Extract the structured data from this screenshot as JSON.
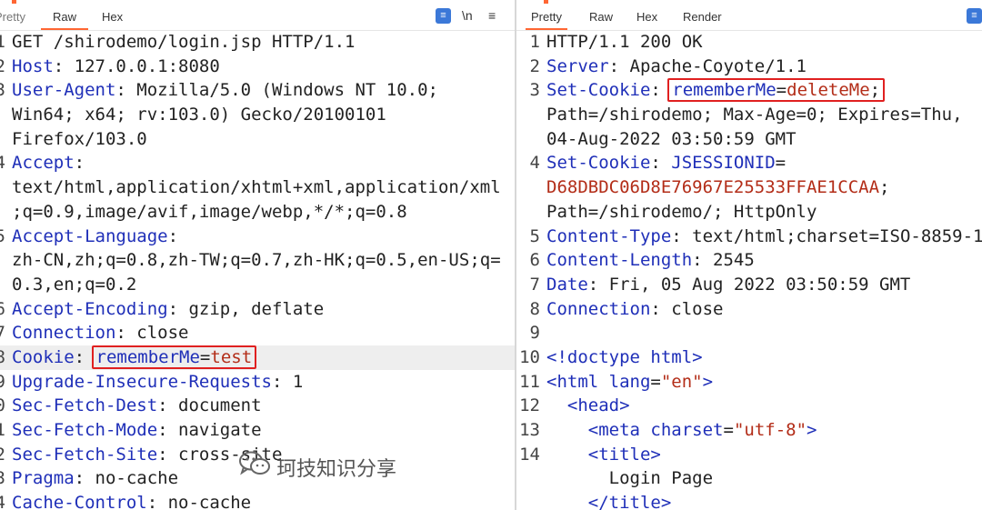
{
  "left": {
    "tabs": [
      "Pretty",
      "Raw",
      "Hex"
    ],
    "tools": {
      "pretty_icon": "text-format-icon",
      "newline": "\\n",
      "menu": "≡"
    },
    "lines": [
      {
        "n": "1",
        "parts": [
          [
            "v",
            "GET /shirodemo/login.jsp HTTP/1.1"
          ]
        ]
      },
      {
        "n": "2",
        "parts": [
          [
            "k",
            "Host"
          ],
          [
            "v",
            ": 127.0.0.1:8080"
          ]
        ]
      },
      {
        "n": "3",
        "parts": [
          [
            "k",
            "User-Agent"
          ],
          [
            "v",
            ": Mozilla/5.0 (Windows NT 10.0;"
          ]
        ]
      },
      {
        "n": "",
        "parts": [
          [
            "v",
            "Win64; x64; rv:103.0) Gecko/20100101"
          ]
        ]
      },
      {
        "n": "",
        "parts": [
          [
            "v",
            "Firefox/103.0"
          ]
        ]
      },
      {
        "n": "4",
        "parts": [
          [
            "k",
            "Accept"
          ],
          [
            "v",
            ":"
          ]
        ]
      },
      {
        "n": "",
        "parts": [
          [
            "v",
            "text/html,application/xhtml+xml,application/xml"
          ]
        ]
      },
      {
        "n": "",
        "parts": [
          [
            "v",
            ";q=0.9,image/avif,image/webp,*/*;q=0.8"
          ]
        ]
      },
      {
        "n": "5",
        "parts": [
          [
            "k",
            "Accept-Language"
          ],
          [
            "v",
            ":"
          ]
        ]
      },
      {
        "n": "",
        "parts": [
          [
            "v",
            "zh-CN,zh;q=0.8,zh-TW;q=0.7,zh-HK;q=0.5,en-US;q="
          ]
        ]
      },
      {
        "n": "",
        "parts": [
          [
            "v",
            "0.3,en;q=0.2"
          ]
        ]
      },
      {
        "n": "6",
        "parts": [
          [
            "k",
            "Accept-Encoding"
          ],
          [
            "v",
            ": gzip, deflate"
          ]
        ]
      },
      {
        "n": "7",
        "parts": [
          [
            "k",
            "Connection"
          ],
          [
            "v",
            ": close"
          ]
        ]
      },
      {
        "n": "8",
        "hl": true,
        "parts": [
          [
            "k",
            "Cookie"
          ],
          [
            "v",
            ": "
          ],
          [
            "box",
            [
              [
                "k",
                "rememberMe"
              ],
              [
                "v",
                "="
              ],
              [
                "red",
                "test"
              ]
            ]
          ]
        ]
      },
      {
        "n": "9",
        "parts": [
          [
            "k",
            "Upgrade-Insecure-Requests"
          ],
          [
            "v",
            ": 1"
          ]
        ]
      },
      {
        "n": "0",
        "parts": [
          [
            "k",
            "Sec-Fetch-Dest"
          ],
          [
            "v",
            ": document"
          ]
        ]
      },
      {
        "n": "1",
        "parts": [
          [
            "k",
            "Sec-Fetch-Mode"
          ],
          [
            "v",
            ": navigate"
          ]
        ]
      },
      {
        "n": "2",
        "parts": [
          [
            "k",
            "Sec-Fetch-Site"
          ],
          [
            "v",
            ": cross-site"
          ]
        ]
      },
      {
        "n": "3",
        "parts": [
          [
            "k",
            "Pragma"
          ],
          [
            "v",
            ": no-cache"
          ]
        ]
      },
      {
        "n": "4",
        "parts": [
          [
            "k",
            "Cache-Control"
          ],
          [
            "v",
            ": no-cache"
          ]
        ]
      }
    ]
  },
  "right": {
    "tabs": [
      "Pretty",
      "Raw",
      "Hex",
      "Render"
    ],
    "tools": {
      "pretty_icon": "text-format-icon"
    },
    "lines": [
      {
        "n": "1",
        "parts": [
          [
            "v",
            "HTTP/1.1 200 OK"
          ]
        ]
      },
      {
        "n": "2",
        "parts": [
          [
            "k",
            "Server"
          ],
          [
            "v",
            ": Apache-Coyote/1.1"
          ]
        ]
      },
      {
        "n": "3",
        "parts": [
          [
            "k",
            "Set-Cookie"
          ],
          [
            "v",
            ": "
          ],
          [
            "box",
            [
              [
                "k",
                "rememberMe"
              ],
              [
                "v",
                "="
              ],
              [
                "red",
                "deleteMe"
              ],
              [
                "v",
                ";"
              ]
            ]
          ]
        ]
      },
      {
        "n": "",
        "parts": [
          [
            "v",
            "Path=/shirodemo; Max-Age=0; Expires=Thu,"
          ]
        ]
      },
      {
        "n": "",
        "parts": [
          [
            "v",
            "04-Aug-2022 03:50:59 GMT"
          ]
        ]
      },
      {
        "n": "4",
        "parts": [
          [
            "k",
            "Set-Cookie"
          ],
          [
            "v",
            ": "
          ],
          [
            "k",
            "JSESSIONID"
          ],
          [
            "v",
            "="
          ]
        ]
      },
      {
        "n": "",
        "parts": [
          [
            "red",
            "D68DBDC06D8E76967E25533FFAE1CCAA"
          ],
          [
            "v",
            ";"
          ]
        ]
      },
      {
        "n": "",
        "parts": [
          [
            "v",
            "Path=/shirodemo/; HttpOnly"
          ]
        ]
      },
      {
        "n": "5",
        "parts": [
          [
            "k",
            "Content-Type"
          ],
          [
            "v",
            ": text/html;charset=ISO-8859-1"
          ]
        ]
      },
      {
        "n": "6",
        "parts": [
          [
            "k",
            "Content-Length"
          ],
          [
            "v",
            ": 2545"
          ]
        ]
      },
      {
        "n": "7",
        "parts": [
          [
            "k",
            "Date"
          ],
          [
            "v",
            ": Fri, 05 Aug 2022 03:50:59 GMT"
          ]
        ]
      },
      {
        "n": "8",
        "parts": [
          [
            "k",
            "Connection"
          ],
          [
            "v",
            ": close"
          ]
        ]
      },
      {
        "n": "9",
        "parts": []
      },
      {
        "n": "10",
        "parts": [
          [
            "tag",
            "<!doctype html>"
          ]
        ]
      },
      {
        "n": "11",
        "parts": [
          [
            "tag",
            "<html "
          ],
          [
            "attr",
            "lang"
          ],
          [
            "v",
            "="
          ],
          [
            "str",
            "\"en\""
          ],
          [
            "tag",
            ">"
          ]
        ]
      },
      {
        "n": "12",
        "parts": [
          [
            "v",
            "  "
          ],
          [
            "tag",
            "<head>"
          ]
        ]
      },
      {
        "n": "13",
        "parts": [
          [
            "v",
            "    "
          ],
          [
            "tag",
            "<meta "
          ],
          [
            "attr",
            "charset"
          ],
          [
            "v",
            "="
          ],
          [
            "str",
            "\"utf-8\""
          ],
          [
            "tag",
            ">"
          ]
        ]
      },
      {
        "n": "14",
        "parts": [
          [
            "v",
            "    "
          ],
          [
            "tag",
            "<title>"
          ]
        ]
      },
      {
        "n": "",
        "parts": [
          [
            "v",
            "      Login Page"
          ]
        ]
      },
      {
        "n": "",
        "parts": [
          [
            "v",
            "    "
          ],
          [
            "tag",
            "</title>"
          ]
        ]
      }
    ]
  },
  "watermark": {
    "text": "珂技知识分享",
    "icon": "wechat-icon"
  }
}
